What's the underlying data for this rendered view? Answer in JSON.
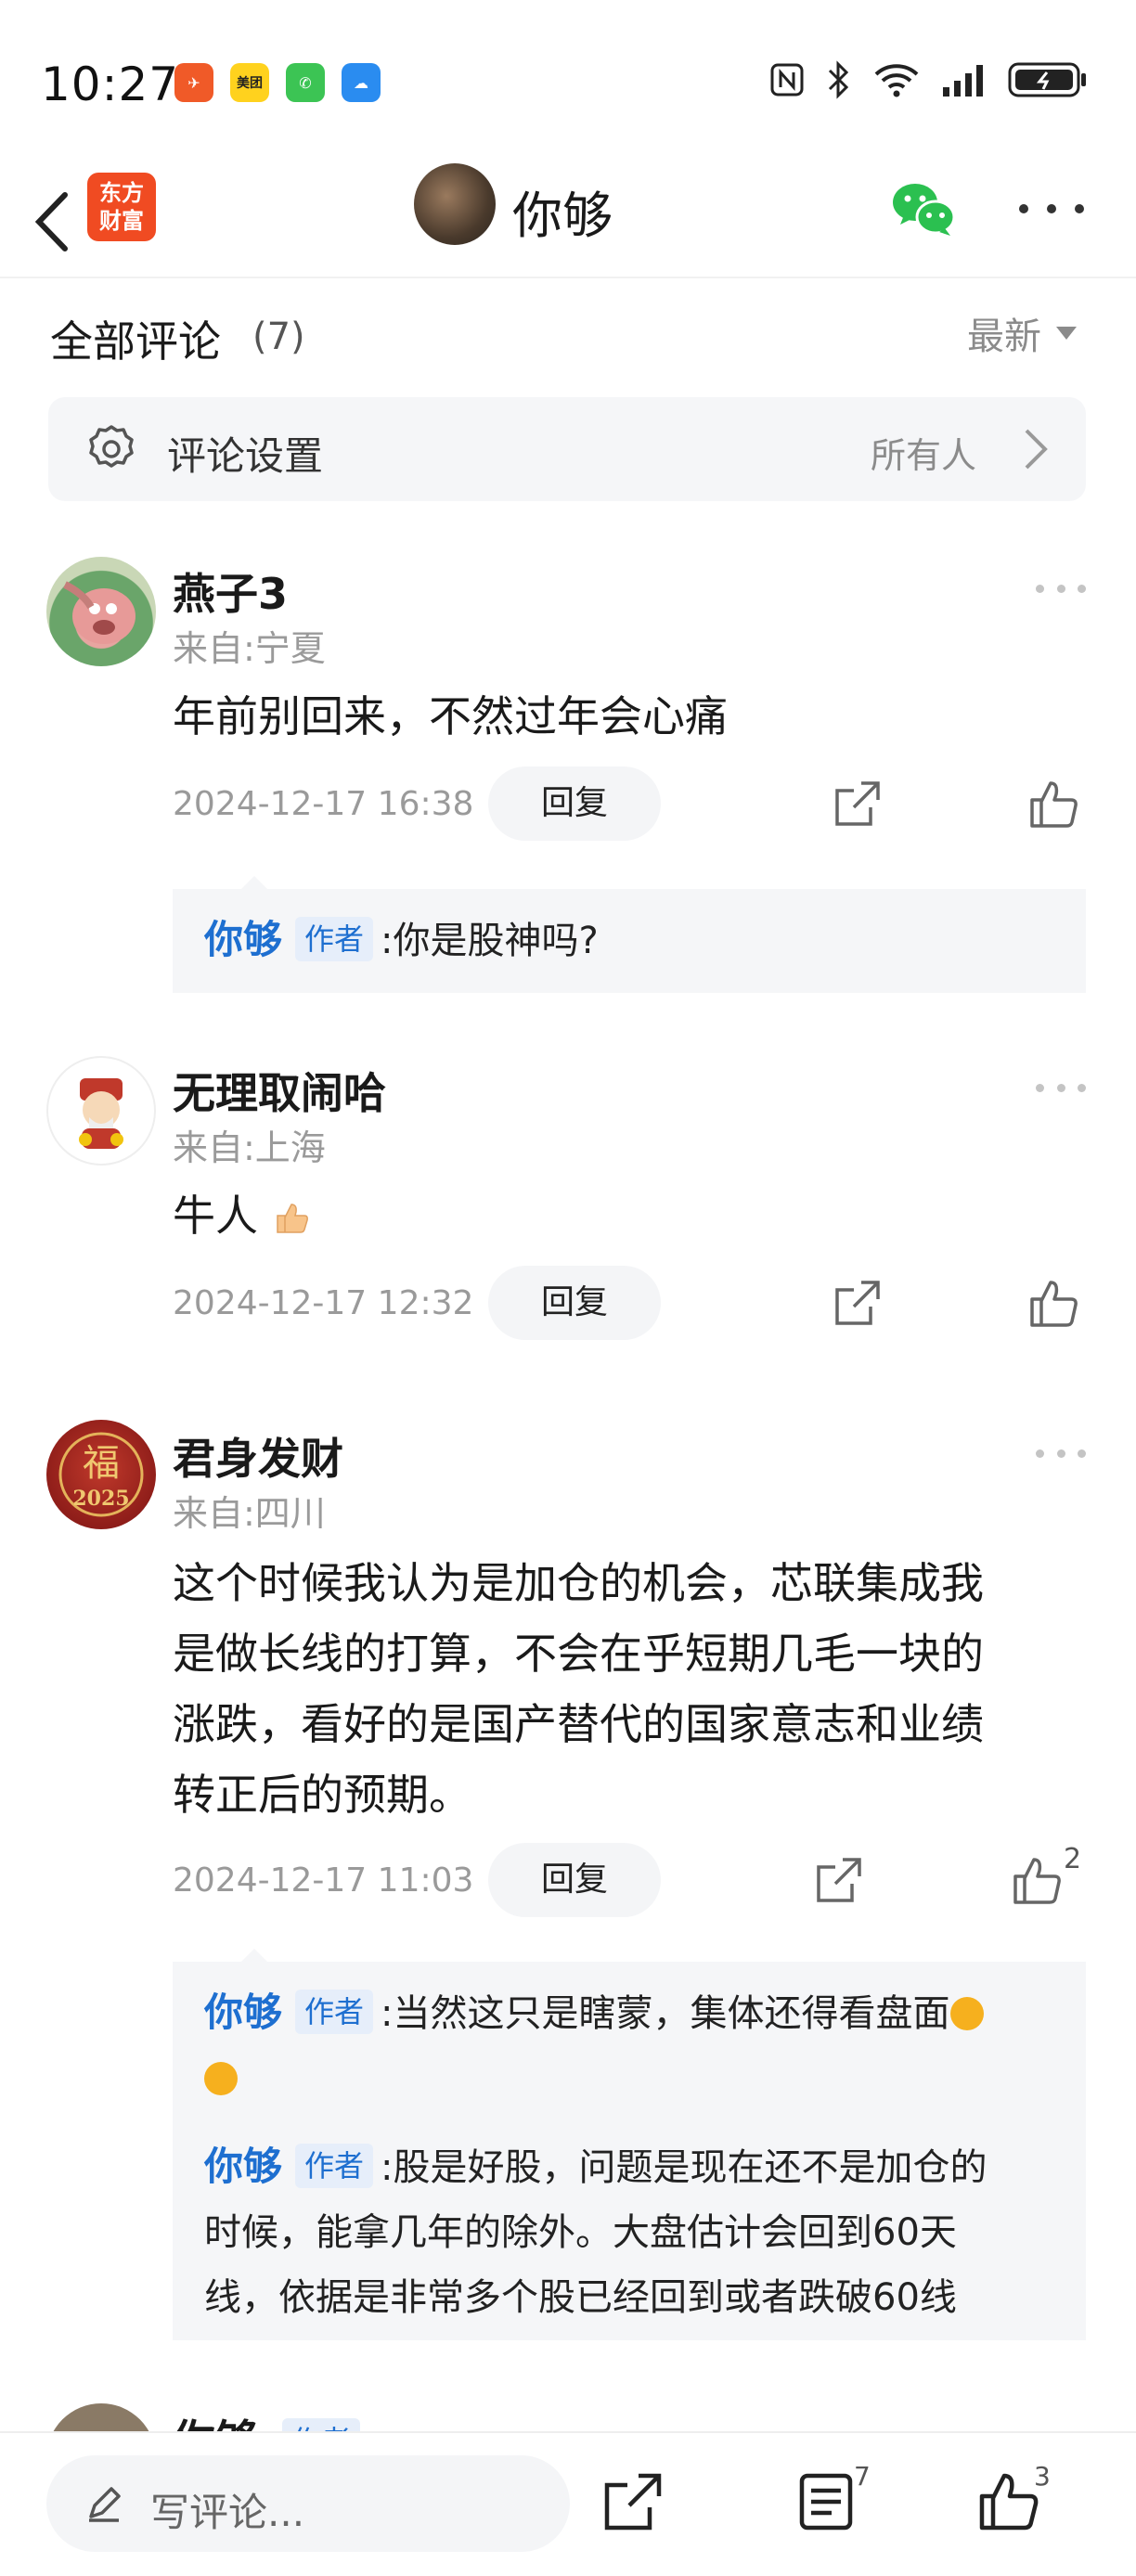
{
  "status_bar": {
    "time": "10:27"
  },
  "nav": {
    "brand": "东方财富",
    "brand_line1": "东方",
    "brand_line2": "财富",
    "title": "你够"
  },
  "comments_header": {
    "title": "全部评论",
    "count": "(7)",
    "sort": "最新"
  },
  "settings": {
    "label": "评论设置",
    "value": "所有人"
  },
  "comments": [
    {
      "name": "燕子3",
      "location": "来自:宁夏",
      "lines": [
        "年前别回来，不然过年会心痛"
      ],
      "time": "2024-12-17 16:38",
      "reply_label": "回复",
      "likes": "",
      "replies": [
        {
          "name": "你够",
          "badge": "作者",
          "text": ":你是股神吗?"
        }
      ]
    },
    {
      "name": "无理取闹哈",
      "location": "来自:上海",
      "lines": [
        "牛人"
      ],
      "time": "2024-12-17 12:32",
      "reply_label": "回复",
      "likes": ""
    },
    {
      "name": "君身发财",
      "location": "来自:四川",
      "lines": [
        "这个时候我认为是加仓的机会，芯联集成我",
        "是做长线的打算，不会在乎短期几毛一块的",
        "涨跌，看好的是国产替代的国家意志和业绩",
        "转正后的预期。"
      ],
      "time": "2024-12-17 11:03",
      "reply_label": "回复",
      "likes": "2",
      "replies": [
        {
          "name": "你够",
          "badge": "作者",
          "text": ":当然这只是瞎蒙，集体还得看盘面"
        },
        {
          "name": "你够",
          "badge": "作者",
          "text": ":股是好股，问题是现在还不是加仓的",
          "cont": [
            "时候，能拿几年的除外。大盘估计会回到60天",
            "线，依据是非常多个股已经回到或者跌破60线"
          ]
        }
      ]
    }
  ],
  "peek": {
    "name": "你够",
    "badge": "作者"
  },
  "bottom_bar": {
    "placeholder": "写评论...",
    "list_count": "7",
    "like_count": "3"
  },
  "colors": {
    "accent_blue": "#1e6fd0",
    "brand_orange": "#f04b22",
    "wechat_green": "#2bc050"
  }
}
